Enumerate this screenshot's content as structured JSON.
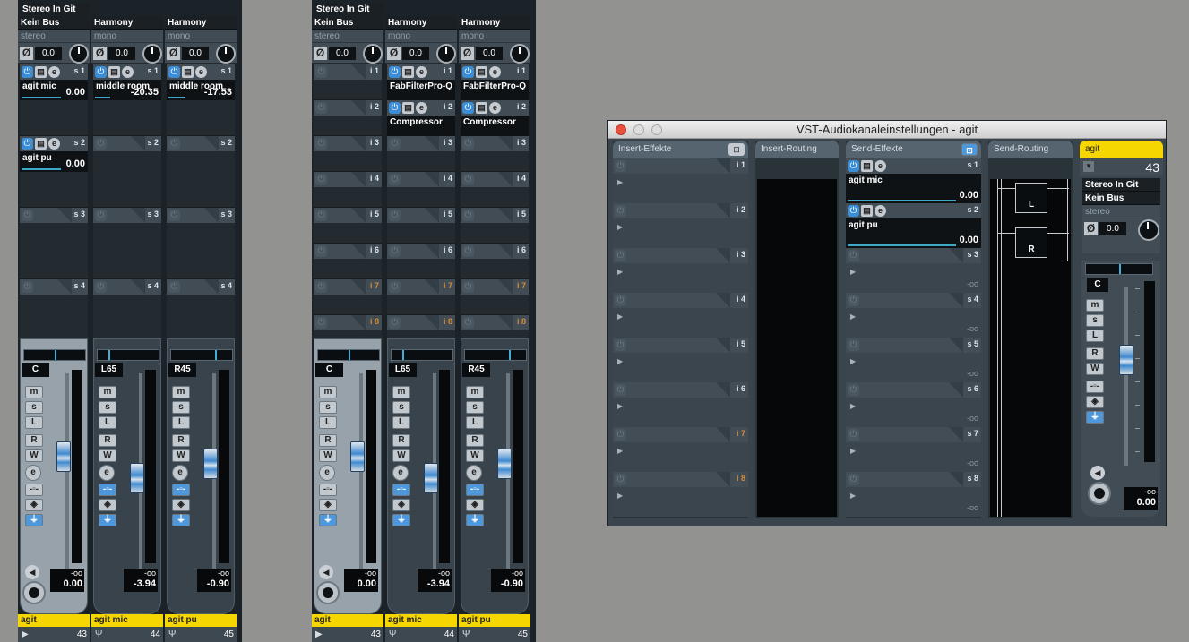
{
  "mixer1": {
    "header": "Stereo In Git",
    "strips": [
      {
        "name": "Kein Bus",
        "mode": "stereo",
        "gain": "0.0",
        "pan": "C",
        "pan_pos": 0.5,
        "vol_peak": "-oo",
        "vol": "0.00",
        "fader": 0.62,
        "foot": "agit",
        "num": "43",
        "icon": "▶",
        "sel": true,
        "sends": [
          {
            "tag": "s 1",
            "on": true,
            "name": "agit mic",
            "value": "0.00",
            "level": 0.8
          },
          {
            "tag": "s 2",
            "on": true,
            "name": "agit pu",
            "value": "0.00",
            "level": 0.8
          },
          {
            "tag": "s 3",
            "on": false
          },
          {
            "tag": "s 4",
            "on": false
          }
        ]
      },
      {
        "name": "Harmony",
        "mode": "mono",
        "gain": "0.0",
        "pan": "L65",
        "pan_pos": 0.18,
        "vol_peak": "-oo",
        "vol": "-3.94",
        "fader": 0.5,
        "foot": "agit mic",
        "num": "44",
        "icon": "Ψ",
        "sel": false,
        "sends": [
          {
            "tag": "s 1",
            "on": true,
            "name": "middle room",
            "value": "-20.35",
            "level": 0.3
          },
          {
            "tag": "s 2",
            "on": false
          },
          {
            "tag": "s 3",
            "on": false
          },
          {
            "tag": "s 4",
            "on": false
          }
        ]
      },
      {
        "name": "Harmony",
        "mode": "mono",
        "gain": "0.0",
        "pan": "R45",
        "pan_pos": 0.72,
        "vol_peak": "-oo",
        "vol": "-0.90",
        "fader": 0.58,
        "foot": "agit pu",
        "num": "45",
        "icon": "Ψ",
        "sel": false,
        "sends": [
          {
            "tag": "s 1",
            "on": true,
            "name": "middle room",
            "value": "-17.53",
            "level": 0.35
          },
          {
            "tag": "s 2",
            "on": false
          },
          {
            "tag": "s 3",
            "on": false
          },
          {
            "tag": "s 4",
            "on": false
          }
        ]
      }
    ]
  },
  "mixer2": {
    "header": "Stereo In Git",
    "strips": [
      {
        "name": "Kein Bus",
        "mode": "stereo",
        "gain": "0.0",
        "pan": "C",
        "pan_pos": 0.5,
        "vol_peak": "-oo",
        "vol": "0.00",
        "fader": 0.62,
        "foot": "agit",
        "num": "43",
        "icon": "▶",
        "sel": true,
        "inserts": [
          {
            "tag": "i 1",
            "on": false
          },
          {
            "tag": "i 2",
            "on": false
          },
          {
            "tag": "i 3"
          },
          {
            "tag": "i 4"
          },
          {
            "tag": "i 5"
          },
          {
            "tag": "i 6"
          },
          {
            "tag": "i 7",
            "orange": true
          },
          {
            "tag": "i 8",
            "orange": true
          }
        ]
      },
      {
        "name": "Harmony",
        "mode": "mono",
        "gain": "0.0",
        "pan": "L65",
        "pan_pos": 0.18,
        "vol_peak": "-oo",
        "vol": "-3.94",
        "fader": 0.5,
        "foot": "agit mic",
        "num": "44",
        "icon": "Ψ",
        "sel": false,
        "inserts": [
          {
            "tag": "i 1",
            "on": true,
            "name": "FabFilterPro-Q"
          },
          {
            "tag": "i 2",
            "on": true,
            "name": "Compressor"
          },
          {
            "tag": "i 3"
          },
          {
            "tag": "i 4"
          },
          {
            "tag": "i 5"
          },
          {
            "tag": "i 6"
          },
          {
            "tag": "i 7",
            "orange": true
          },
          {
            "tag": "i 8",
            "orange": true
          }
        ]
      },
      {
        "name": "Harmony",
        "mode": "mono",
        "gain": "0.0",
        "pan": "R45",
        "pan_pos": 0.72,
        "vol_peak": "-oo",
        "vol": "-0.90",
        "fader": 0.58,
        "foot": "agit pu",
        "num": "45",
        "icon": "Ψ",
        "sel": false,
        "inserts": [
          {
            "tag": "i 1",
            "on": true,
            "name": "FabFilterPro-Q"
          },
          {
            "tag": "i 2",
            "on": true,
            "name": "Compressor"
          },
          {
            "tag": "i 3"
          },
          {
            "tag": "i 4"
          },
          {
            "tag": "i 5"
          },
          {
            "tag": "i 6"
          },
          {
            "tag": "i 7",
            "orange": true
          },
          {
            "tag": "i 8",
            "orange": true
          }
        ]
      }
    ]
  },
  "window": {
    "title": "VST-Audiokanaleinstellungen - agit",
    "insert_header": "Insert-Effekte",
    "insert_routing_header": "Insert-Routing",
    "send_header": "Send-Effekte",
    "send_routing_header": "Send-Routing",
    "insert_slots": [
      {
        "tag": "i 1"
      },
      {
        "tag": "i 2"
      },
      {
        "tag": "i 3"
      },
      {
        "tag": "i 4"
      },
      {
        "tag": "i 5"
      },
      {
        "tag": "i 6"
      },
      {
        "tag": "i 7",
        "orange": true
      },
      {
        "tag": "i 8",
        "orange": true
      }
    ],
    "send_slots": [
      {
        "tag": "s 1",
        "on": true,
        "name": "agit mic",
        "value": "0.00",
        "level": 0.8
      },
      {
        "tag": "s 2",
        "on": true,
        "name": "agit pu",
        "value": "0.00",
        "level": 0.8
      },
      {
        "tag": "s 3",
        "value": "-oo"
      },
      {
        "tag": "s 4",
        "value": "-oo"
      },
      {
        "tag": "s 5",
        "value": "-oo"
      },
      {
        "tag": "s 6",
        "value": "-oo"
      },
      {
        "tag": "s 7",
        "value": "-oo"
      },
      {
        "tag": "s 8",
        "value": "-oo"
      }
    ],
    "routing_left": "L",
    "routing_right": "R",
    "channel": {
      "name": "agit",
      "number": "43",
      "input": "Stereo In Git",
      "output": "Kein Bus",
      "mode": "stereo",
      "gain": "0.0",
      "pan": "C",
      "pan_pos": 0.5,
      "vol_peak": "-oo",
      "vol": "0.00",
      "fader": 0.62
    }
  },
  "buttons": {
    "m": "m",
    "s": "s",
    "l": "L",
    "r": "R",
    "w": "W",
    "e": "e"
  }
}
